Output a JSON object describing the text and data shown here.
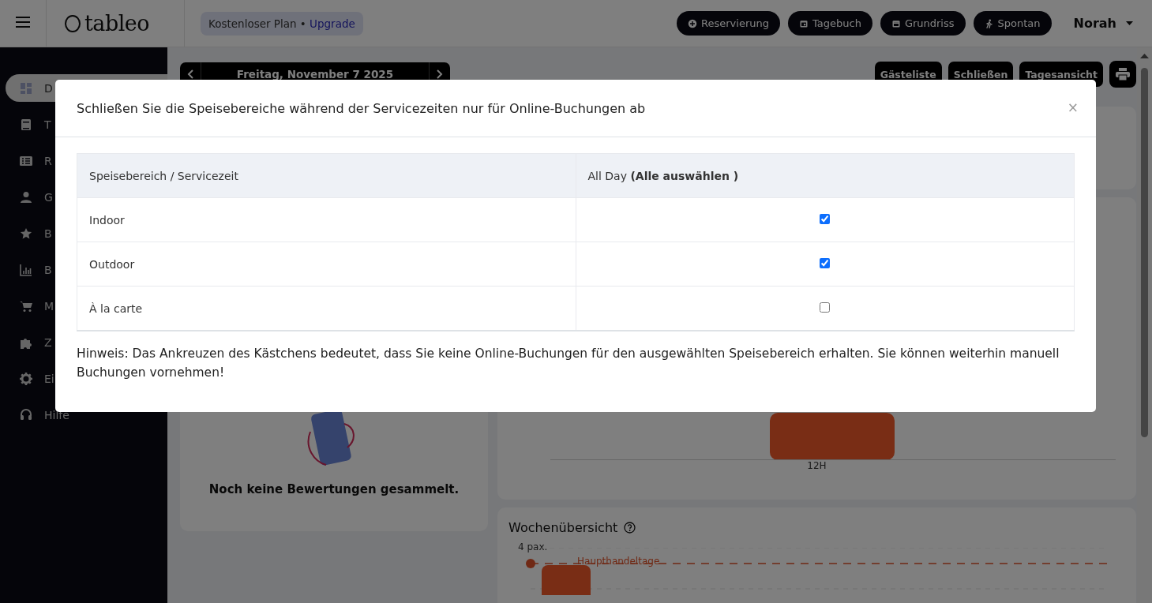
{
  "topbar": {
    "logo": "tableo",
    "plan_badge": {
      "plan": "Kostenloser Plan •",
      "link": "Upgrade"
    },
    "actions": [
      {
        "label": "Reservierung"
      },
      {
        "label": "Tagebuch"
      },
      {
        "label": "Grundriss"
      },
      {
        "label": "Spontan"
      }
    ],
    "user": "Norah"
  },
  "sidebar": {
    "items": [
      {
        "label": "D",
        "selected": true
      },
      {
        "label": "T",
        "selected": false
      },
      {
        "label": "R",
        "selected": false
      },
      {
        "label": "G",
        "selected": false
      },
      {
        "label": "B",
        "selected": false
      },
      {
        "label": "B",
        "selected": false
      },
      {
        "label": "M",
        "selected": false
      },
      {
        "label": "Z",
        "selected": false
      },
      {
        "label": "Ei",
        "selected": false
      },
      {
        "label": "Hilfe",
        "selected": false
      }
    ]
  },
  "date_nav": {
    "date": "Freitag, November 7 2025"
  },
  "view_buttons": [
    "Gästeliste",
    "Schließen",
    "Tagesansicht"
  ],
  "reviews_card": {
    "empty_text": "Noch keine Bewertungen gesammelt."
  },
  "hourly_card": {
    "x_label": "12H"
  },
  "weekly_card": {
    "title": "Wochenübersicht",
    "y_label": "4 pax.",
    "marker_label": "Haupthandeltage"
  },
  "modal": {
    "title": "Schließen Sie die Speisebereiche während der Servicezeiten nur für Online-Buchungen ab",
    "close": "×",
    "table": {
      "columns": [
        "Speisebereich / Servicezeit",
        "All Day **(Alle auswählen )**"
      ],
      "rows": [
        {
          "area": "Indoor",
          "checked": true
        },
        {
          "area": "Outdoor",
          "checked": true
        },
        {
          "area": "À la carte",
          "checked": false
        }
      ]
    },
    "note": "Hinweis: Das Ankreuzen des Kästchens bedeutet, dass Sie keine Online-Buchungen für den ausgewählten Speisebereich erhalten. Sie können weiterhin manuell Buchungen vornehmen!"
  }
}
